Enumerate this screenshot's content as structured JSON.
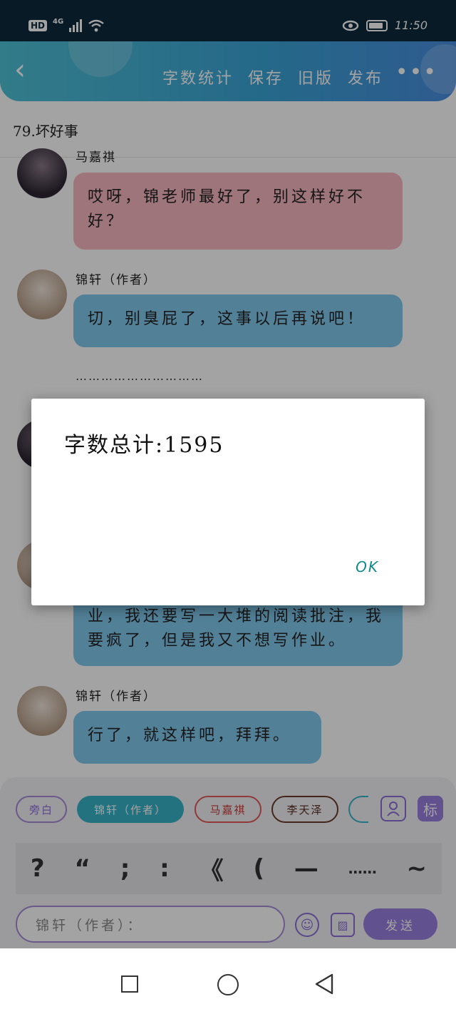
{
  "status_bar": {
    "network": "4G",
    "hd": "HD",
    "time": "11:50"
  },
  "header": {
    "buttons": [
      "字数统计",
      "保存",
      "旧版",
      "发布"
    ],
    "more": "•••",
    "back": "‹"
  },
  "story": {
    "title": "79.坏好事"
  },
  "messages": [
    {
      "speaker": "马嘉祺",
      "text": "哎呀，锦老师最好了，别这样好不好？"
    },
    {
      "speaker": "锦轩（作者）",
      "text": "切，别臭屁了，这事以后再说吧！"
    },
    {
      "text": "业，我还要写一大堆的阅读批注，我要疯了，但是我又不想写作业。"
    },
    {
      "speaker": "锦轩（作者）",
      "text": "行了，就这样吧，拜拜。"
    }
  ],
  "ellipsis": "…………………………",
  "toolbar": {
    "chips": [
      "旁白",
      "锦轩（作者）",
      "马嘉祺",
      "李天泽"
    ],
    "mark_button": "标",
    "punctuation": [
      "?",
      "“",
      ";",
      ":",
      "《",
      "(",
      "—",
      "……",
      "~"
    ],
    "input_value": "锦轩（作者）：",
    "send_label": "发送"
  },
  "dialog": {
    "message": "字数总计:1595",
    "ok_label": "OK"
  },
  "colors": {
    "header_start": "#4fc1d6",
    "bubble_pink": "#f6b7c0",
    "bubble_blue": "#80c8ec",
    "accent_purple": "#9a7fe0",
    "dialog_ok": "#0e8a8a"
  },
  "icons": [
    "back-arrow-icon",
    "more-icon",
    "eye-icon",
    "battery-icon",
    "wifi-icon",
    "person-icon",
    "emoji-icon",
    "image-icon"
  ]
}
